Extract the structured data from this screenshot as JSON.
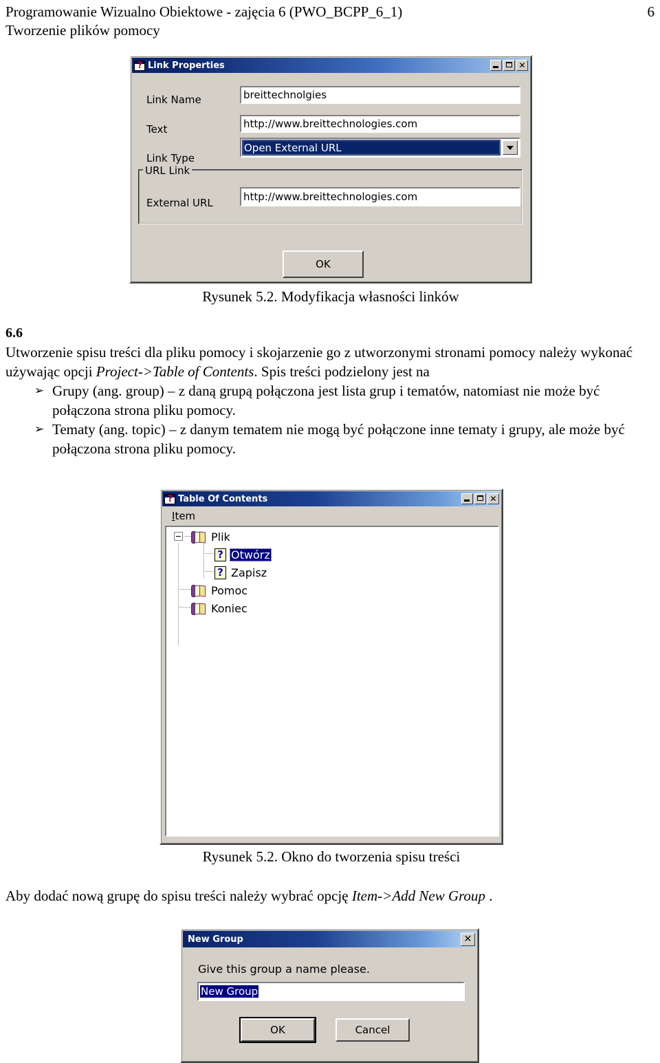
{
  "header": {
    "line1": "Programowanie Wizualno Obiektowe - zajęcia 6 (PWO_BCPP_6_1)",
    "line2": "Tworzenie plików pomocy",
    "page_number": "6"
  },
  "link_properties_dialog": {
    "title": "Link Properties",
    "icon": "help-document-icon",
    "window_buttons": {
      "minimize": "minimize-button",
      "maximize": "maximize-button",
      "close_label": "✕"
    },
    "fields": [
      {
        "label": "Link Name",
        "value": "breittechnolgies"
      },
      {
        "label": "Text",
        "value": "http://www.breittechnologies.com"
      }
    ],
    "link_type": {
      "label": "Link Type",
      "selected": "Open External URL"
    },
    "url_group": {
      "legend": "URL Link",
      "field_label": "External URL",
      "field_value": "http://www.breittechnologies.com"
    },
    "ok_label": "OK"
  },
  "caption_1": "Rysunek 5.2. Modyfikacja własności linków",
  "section": {
    "number": "6.6",
    "paragraph_part1": "Utworzenie spisu treści dla pliku pomocy i skojarzenie go z utworzonymi stronami pomocy należy wykonać używając opcji ",
    "paragraph_italic": "Project->Table of Contents",
    "paragraph_part2": ". Spis treści podzielony jest na",
    "bullets": [
      {
        "marker": "➢",
        "text": "Grupy (ang. group) – z daną grupą połączona jest lista grup i tematów, natomiast nie może być połączona strona pliku pomocy."
      },
      {
        "marker": "➢",
        "text": "Tematy (ang. topic) – z danym tematem nie mogą być połączone inne tematy i grupy, ale może być połączona strona pliku pomocy."
      }
    ]
  },
  "toc_dialog": {
    "title": "Table Of Contents",
    "icon": "help-document-icon",
    "menu": [
      {
        "label": "Item",
        "mnemonic": "I"
      }
    ],
    "window_buttons": {
      "minimize": "minimize-button",
      "maximize": "maximize-button",
      "close_label": "✕"
    },
    "tree": [
      {
        "label": "Plik",
        "type": "group",
        "depth": 0,
        "expanded": true,
        "selected": false
      },
      {
        "label": "Otwórz",
        "type": "topic",
        "depth": 1,
        "expanded": false,
        "selected": true
      },
      {
        "label": "Zapisz",
        "type": "topic",
        "depth": 1,
        "expanded": false,
        "selected": false
      },
      {
        "label": "Pomoc",
        "type": "group",
        "depth": 0,
        "expanded": false,
        "selected": false
      },
      {
        "label": "Koniec",
        "type": "group",
        "depth": 0,
        "expanded": false,
        "selected": false
      }
    ]
  },
  "caption_2": "Rysunek 5.2. Okno do tworzenia spisu treści",
  "paragraph_add_group": {
    "part1": "Aby dodać nową grupę do spisu treści należy wybrać opcję ",
    "italic": "Item->Add New Group",
    "part2": " ."
  },
  "new_group_dialog": {
    "title": "New Group",
    "close_label": "✕",
    "prompt_before": "Give this ",
    "prompt_mnemonic": "g",
    "prompt_after": "roup a name please.",
    "input_value": "New Group",
    "ok_label": "OK",
    "cancel_label": "Cancel"
  },
  "colors": {
    "title_active_start": "#0a246a",
    "title_active_end": "#a6caf0",
    "dialog_face": "#d4d0c8",
    "selection": "#000080",
    "field_bg": "#ffffff"
  }
}
